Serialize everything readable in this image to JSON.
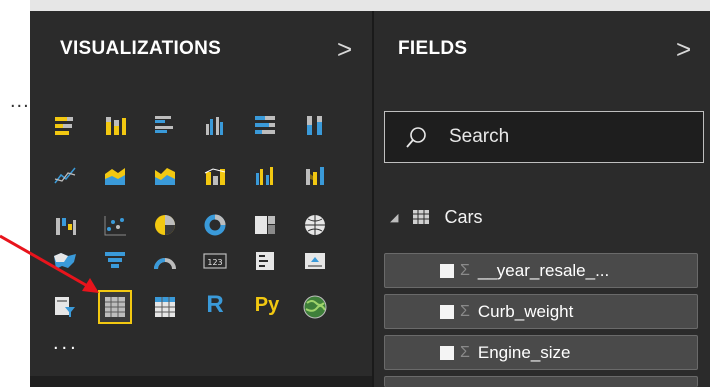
{
  "visualizations": {
    "title": "VISUALIZATIONS",
    "expand_glyph": ">",
    "more_glyph": "...",
    "icons": [
      "stacked-bar-chart-icon",
      "stacked-column-chart-icon",
      "clustered-bar-chart-icon",
      "clustered-column-chart-icon",
      "100-stacked-bar-chart-icon",
      "100-stacked-column-chart-icon",
      "line-chart-icon",
      "area-chart-icon",
      "stacked-area-chart-icon",
      "line-and-stacked-column-chart-icon",
      "line-and-clustered-column-chart-icon",
      "ribbon-chart-icon",
      "waterfall-chart-icon",
      "scatter-chart-icon",
      "pie-chart-icon",
      "donut-chart-icon",
      "treemap-icon",
      "map-icon",
      "filled-map-icon",
      "funnel-icon",
      "gauge-icon",
      "card-icon",
      "multi-row-card-icon",
      "kpi-icon",
      "slicer-icon",
      "table-icon",
      "matrix-icon",
      "r-script-visual-icon",
      "python-visual-icon",
      "arcgis-map-icon"
    ],
    "r_label": "R",
    "py_label": "Py",
    "card_label": "123",
    "selected_icon": "table-icon"
  },
  "left_more_glyph": "...",
  "fields": {
    "title": "FIELDS",
    "expand_glyph": ">",
    "search_placeholder": "Search",
    "table_name": "Cars",
    "items": [
      {
        "name": "__year_resale_...",
        "sigma": "Σ"
      },
      {
        "name": "Curb_weight",
        "sigma": "Σ"
      },
      {
        "name": "Engine_size",
        "sigma": "Σ"
      }
    ]
  },
  "colors": {
    "panel_bg": "#2b2b2b",
    "selected_outline": "#f2c811",
    "annotation_arrow": "#e8141c",
    "accent_yellow": "#f2c811",
    "accent_blue": "#3a9ad9"
  }
}
